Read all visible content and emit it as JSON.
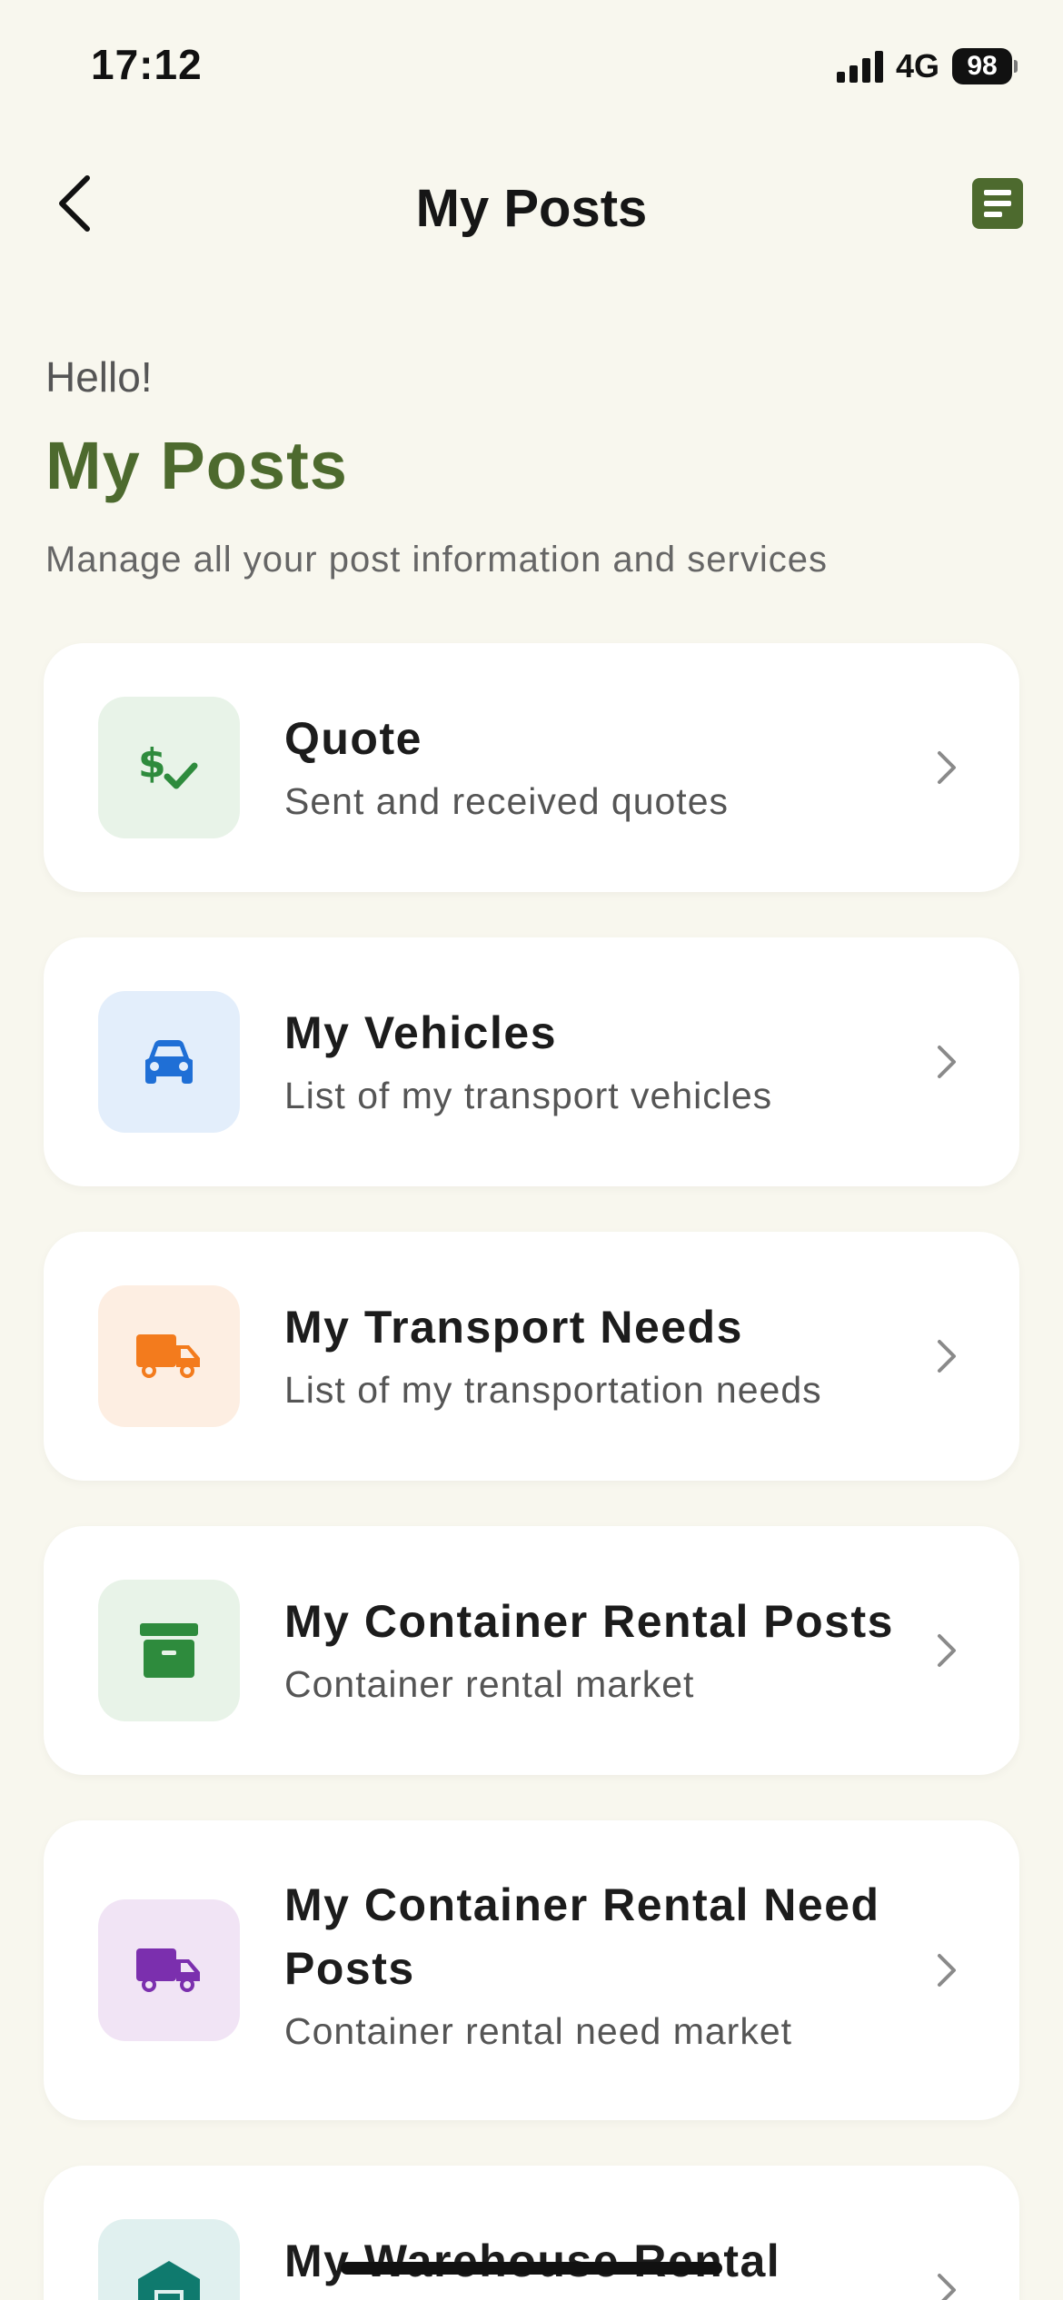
{
  "status_bar": {
    "time": "17:12",
    "network": "4G",
    "battery": "98"
  },
  "nav": {
    "title": "My Posts"
  },
  "header": {
    "greeting": "Hello!",
    "heading": "My Posts",
    "subtitle": "Manage all your post information and services"
  },
  "cards": [
    {
      "title": "Quote",
      "description": "Sent and received quotes",
      "icon": "dollar-check-icon",
      "icon_bg": "#e8f3e8",
      "icon_color": "#2e8b3d"
    },
    {
      "title": "My Vehicles",
      "description": "List of my transport vehicles",
      "icon": "car-icon",
      "icon_bg": "#e3eefb",
      "icon_color": "#1f6fd6"
    },
    {
      "title": "My Transport Needs",
      "description": "List of my transportation needs",
      "icon": "truck-icon",
      "icon_bg": "#fdeee2",
      "icon_color": "#f37b1d"
    },
    {
      "title": "My Container Rental Posts",
      "description": "Container rental market",
      "icon": "archive-box-icon",
      "icon_bg": "#e8f3e8",
      "icon_color": "#2e8b3d"
    },
    {
      "title": "My Container Rental Need Posts",
      "description": "Container rental need market",
      "icon": "truck-icon",
      "icon_bg": "#f1e4f5",
      "icon_color": "#7b2fae"
    },
    {
      "title": "My Warehouse Rental Posts",
      "description": "",
      "icon": "warehouse-icon",
      "icon_bg": "#e0f0ef",
      "icon_color": "#0f7a6e"
    }
  ]
}
